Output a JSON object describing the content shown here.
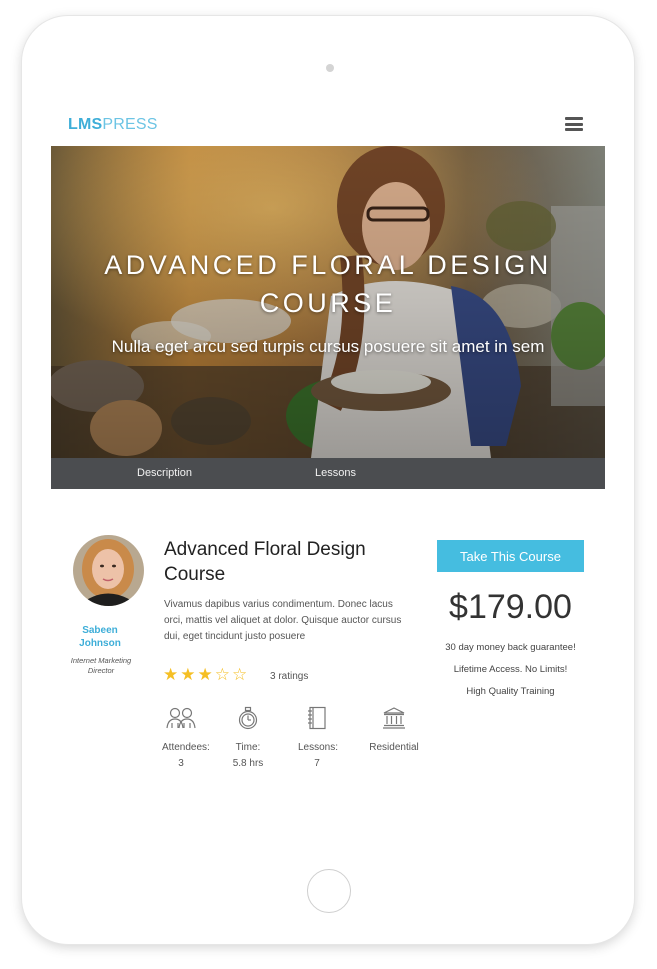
{
  "logo": {
    "part1": "LMS",
    "part2": "PRESS"
  },
  "hero": {
    "title_line1": "ADVANCED FLORAL DESIGN",
    "title_line2": "COURSE",
    "subtitle": "Nulla eget arcu sed turpis cursus posuere sit amet in sem"
  },
  "tabs": [
    {
      "label": "Description"
    },
    {
      "label": "Lessons"
    }
  ],
  "author": {
    "name": "Sabeen Johnson",
    "role": "Internet Marketing Director"
  },
  "course": {
    "title": "Advanced Floral Design Course",
    "description": "Vivamus dapibus varius condimentum. Donec lacus orci, mattis vel aliquet at dolor. Quisque auctor cursus dui, eget tincidunt justo posuere",
    "rating": 3,
    "rating_max": 5,
    "ratings_text": "3 ratings"
  },
  "stats": [
    {
      "icon": "attendees-icon",
      "label": "Attendees:",
      "value": "3"
    },
    {
      "icon": "stopwatch-icon",
      "label": "Time:",
      "value": "5.8 hrs"
    },
    {
      "icon": "notebook-icon",
      "label": "Lessons:",
      "value": "7"
    },
    {
      "icon": "building-icon",
      "label": "Residential",
      "value": ""
    }
  ],
  "purchase": {
    "button_label": "Take This Course",
    "price": "$179.00",
    "perks": [
      "30 day money back guarantee!",
      "Lifetime Access. No Limits!",
      "High Quality Training"
    ]
  },
  "colors": {
    "accent": "#45bde0",
    "logo": "#3eaed8",
    "tabbar": "#4b4d50",
    "star": "#f5bf24"
  }
}
